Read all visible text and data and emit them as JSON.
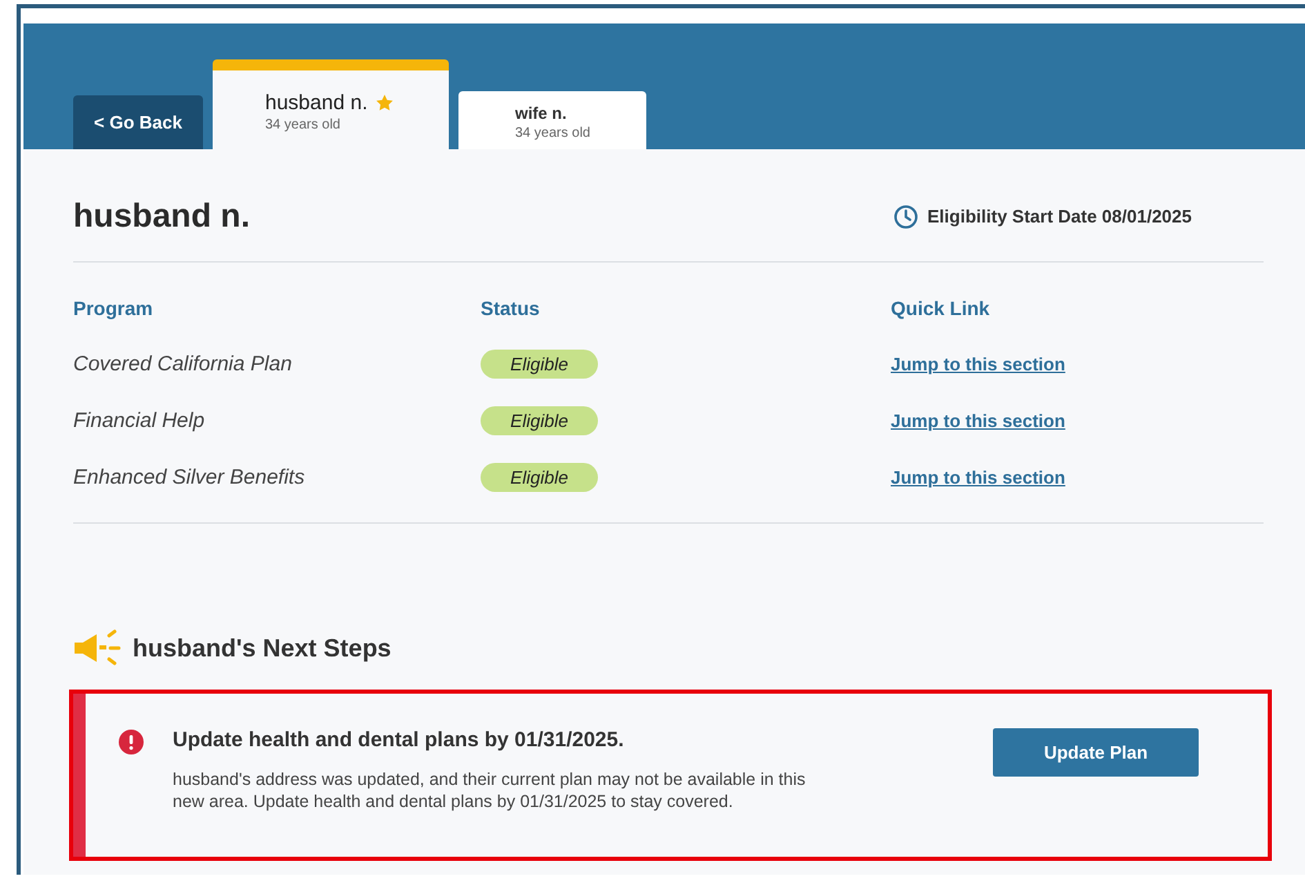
{
  "back_button": {
    "label": "< Go Back"
  },
  "tabs": [
    {
      "name": "husband n.",
      "age": "34 years old",
      "selected": true,
      "starred": true
    },
    {
      "name": "wife n.",
      "age": "34 years old",
      "selected": false,
      "starred": false
    }
  ],
  "person": {
    "name": "husband n.",
    "eligibility": "Eligibility Start Date 08/01/2025"
  },
  "table": {
    "columns": [
      "Program",
      "Status",
      "Quick Link"
    ],
    "rows": [
      {
        "program": "Covered California Plan",
        "status": "Eligible",
        "link": "Jump to this section"
      },
      {
        "program": "Financial Help",
        "status": "Eligible",
        "link": "Jump to this section"
      },
      {
        "program": "Enhanced Silver Benefits",
        "status": "Eligible",
        "link": "Jump to this section"
      }
    ]
  },
  "next_steps": {
    "title": "husband's Next Steps",
    "alerts": [
      {
        "kind": "error",
        "highlighted": true,
        "title": "Update health and dental plans by 01/31/2025.",
        "body": "husband's address was updated, and their current plan may not be available in this new area. Update health and dental plans by 01/31/2025 to stay covered.",
        "button": "Update Plan"
      }
    ]
  }
}
